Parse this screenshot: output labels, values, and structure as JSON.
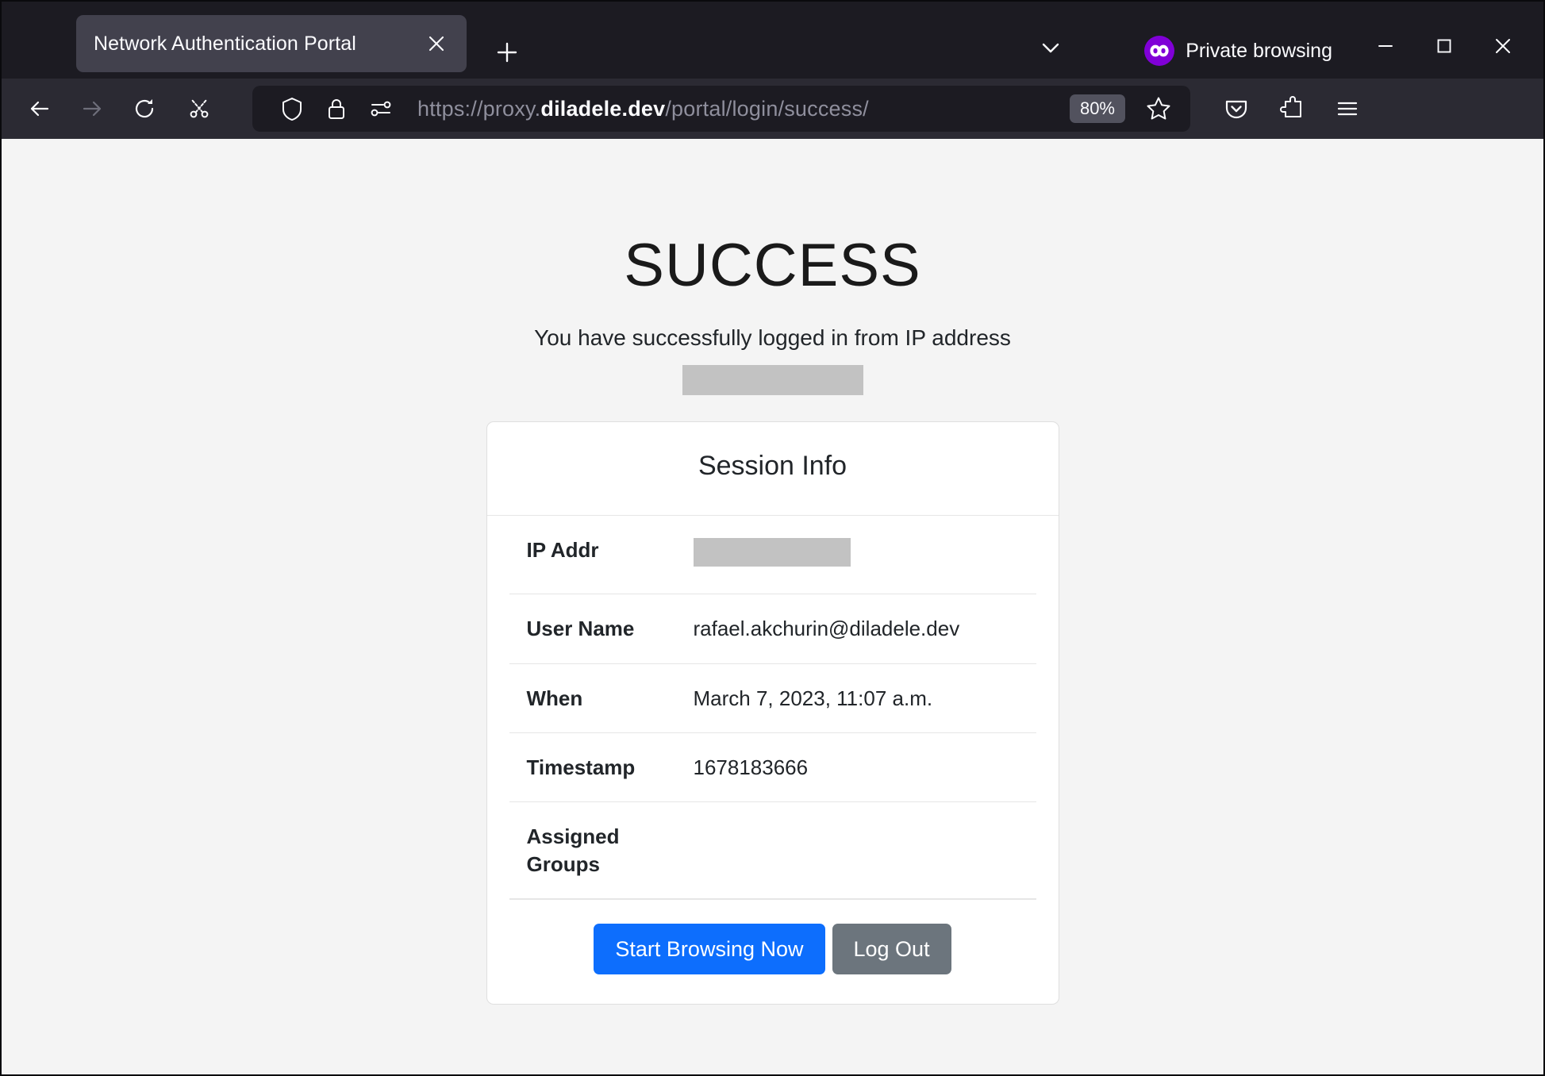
{
  "browser": {
    "tab": {
      "title": "Network Authentication Portal",
      "close_label": "Close tab",
      "close_icon": "close-icon"
    },
    "new_tab_label": "Open a new tab",
    "all_tabs_label": "List all tabs",
    "private_browsing": {
      "label": "Private browsing",
      "icon": "private-mask-icon",
      "accent_color": "#8000d7"
    },
    "window_controls": {
      "minimize": "Minimize",
      "maximize": "Maximize",
      "close": "Close"
    },
    "nav": {
      "back": "Go back one page",
      "forward": "Go forward one page",
      "reload": "Reload current page",
      "screenshot": "Take a screenshot"
    },
    "urlbar": {
      "shield_label": "Enhanced Tracking Protection",
      "lock_label": "Connection is secure",
      "permissions_label": "Site information",
      "url_scheme": "https://proxy.",
      "url_host": "diladele.dev",
      "url_path": "/portal/login/success/",
      "full_url": "https://proxy.diladele.dev/portal/login/success/",
      "zoom_level": "80%",
      "bookmark_label": "Bookmark this page"
    },
    "toolbar_right": {
      "pocket": "Save to Pocket",
      "extensions": "Extensions",
      "menu": "Open application menu"
    }
  },
  "page": {
    "heading": "SUCCESS",
    "subtitle": "You have successfully logged in from IP address",
    "ip_redacted": "",
    "card": {
      "title": "Session Info",
      "rows": [
        {
          "label": "IP Addr",
          "value": "",
          "redacted": true
        },
        {
          "label": "User Name",
          "value": "rafael.akchurin@diladele.dev",
          "redacted": false
        },
        {
          "label": "When",
          "value": "March 7, 2023, 11:07 a.m.",
          "redacted": false
        },
        {
          "label": "Timestamp",
          "value": "1678183666",
          "redacted": false
        },
        {
          "label": "Assigned Groups",
          "value": "",
          "redacted": false
        }
      ],
      "primary_button": "Start Browsing Now",
      "secondary_button": "Log Out",
      "primary_color": "#0d6efd",
      "secondary_color": "#6c757d"
    }
  }
}
